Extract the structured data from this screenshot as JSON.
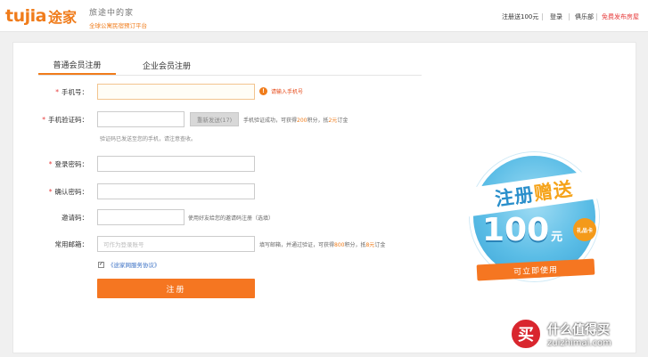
{
  "header": {
    "logo_latin": "tujia",
    "logo_cn": "途家",
    "slogan_main": "旅途中的家",
    "slogan_sub": "全球公寓民宿预订平台",
    "nav": {
      "register_gift": "注册送100元",
      "login": "登录",
      "club": "俱乐部",
      "publish": "免费发布房屋"
    }
  },
  "tabs": {
    "personal": "普通会员注册",
    "enterprise": "企业会员注册"
  },
  "form": {
    "phone": {
      "label": "手机号：",
      "value": "",
      "error": "请输入手机号"
    },
    "sms_code": {
      "label": "手机验证码：",
      "value": "",
      "resend_label": "重新发送(17)",
      "hint_prefix": "手机验证成功，可获得",
      "hint_points": "200",
      "hint_mid": "积分，抵",
      "hint_money": "2元",
      "hint_suffix": "订金",
      "sent_note": "验证码已发送至您的手机，请注意查收。"
    },
    "password": {
      "label": "登录密码：",
      "value": ""
    },
    "confirm_password": {
      "label": "确认密码：",
      "value": ""
    },
    "invite_code": {
      "label": "邀请码：",
      "value": "",
      "hint": "使用好友给您的邀请码注册（选填）"
    },
    "email": {
      "label": "常用邮箱：",
      "placeholder": "可作为登录账号",
      "hint_prefix": "填写邮箱，并通过验证，可获得",
      "hint_points": "800",
      "hint_mid": "积分，抵",
      "hint_money": "8元",
      "hint_suffix": "订金"
    },
    "agreement": {
      "checked": true,
      "check_mark": "✓",
      "label": "《途家网服务协议》"
    },
    "submit_label": "注册"
  },
  "promo": {
    "title_left": "注册",
    "title_right": "赠送",
    "amount": "100",
    "unit": "元",
    "tag": "礼品卡",
    "cta": "可立即使用"
  },
  "watermark": {
    "badge": "买",
    "text_cn": "什么值得买",
    "url": "zuizhimai.com"
  },
  "colors": {
    "brand": "#f07c1b",
    "submit": "#f57621",
    "promo_blue": "#5bbde6",
    "link": "#3a70c4"
  }
}
